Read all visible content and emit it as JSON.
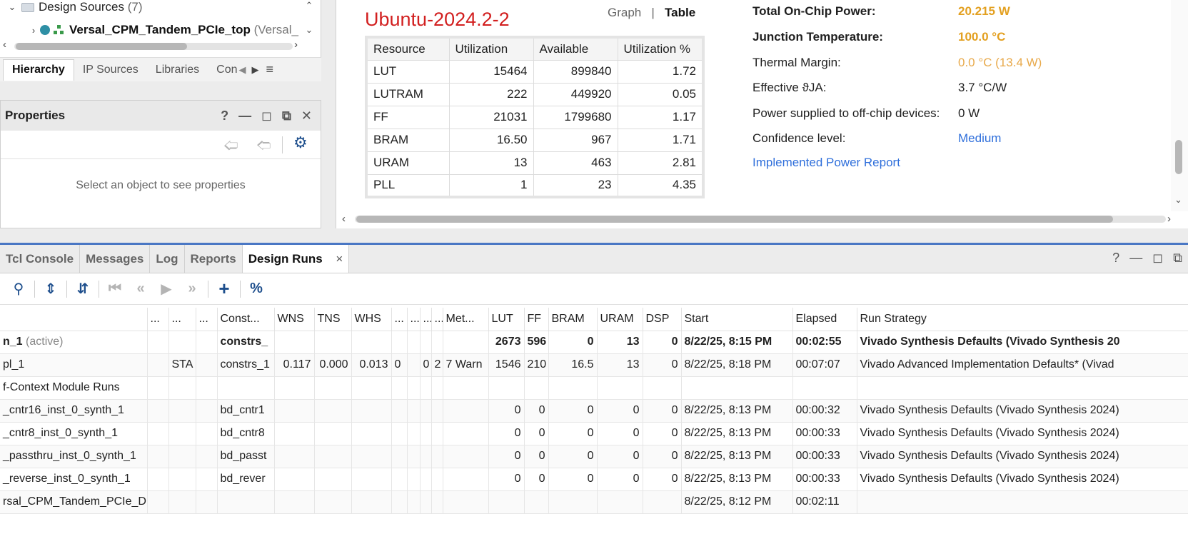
{
  "sources": {
    "design_sources_label": "Design Sources",
    "design_sources_count": "(7)",
    "top_module": "Versal_CPM_Tandem_PCIe_top",
    "top_module_suffix": "(Versal_",
    "tabs": [
      "Hierarchy",
      "IP Sources",
      "Libraries",
      "Con"
    ]
  },
  "properties": {
    "title": "Properties",
    "empty_message": "Select an object to see properties"
  },
  "dashboard": {
    "title": "Ubuntu-2024.2-2",
    "view_graph": "Graph",
    "view_sep": "|",
    "view_table": "Table",
    "util_headers": [
      "Resource",
      "Utilization",
      "Available",
      "Utilization %"
    ],
    "util_rows": [
      [
        "LUT",
        "15464",
        "899840",
        "1.72"
      ],
      [
        "LUTRAM",
        "222",
        "449920",
        "0.05"
      ],
      [
        "FF",
        "21031",
        "1799680",
        "1.17"
      ],
      [
        "BRAM",
        "16.50",
        "967",
        "1.71"
      ],
      [
        "URAM",
        "13",
        "463",
        "2.81"
      ],
      [
        "PLL",
        "1",
        "23",
        "4.35"
      ]
    ],
    "power": {
      "total_label": "Total On-Chip Power:",
      "total_value": "20.215 W",
      "junction_label": "Junction Temperature:",
      "junction_value": "100.0 °C",
      "margin_label": "Thermal Margin:",
      "margin_value": "0.0 °C (13.4 W)",
      "theta_label": "Effective ϑJA:",
      "theta_value": "3.7 °C/W",
      "offchip_label": "Power supplied to off-chip devices:",
      "offchip_value": "0 W",
      "confidence_label": "Confidence level:",
      "confidence_value": "Medium",
      "report_link": "Implemented Power Report"
    }
  },
  "bottom": {
    "tabs": [
      "Tcl Console",
      "Messages",
      "Log",
      "Reports",
      "Design Runs"
    ],
    "close_glyph": "×",
    "headers": [
      "",
      "...",
      "...",
      "...",
      "Const...",
      "WNS",
      "TNS",
      "WHS",
      "...",
      "...",
      "...",
      "...",
      "Met...",
      "LUT",
      "FF",
      "BRAM",
      "URAM",
      "DSP",
      "Start",
      "Elapsed",
      "Run Strategy"
    ],
    "rows": [
      {
        "name": "n_1",
        "name_suffix": "(active)",
        "c": [
          "",
          "",
          "",
          "constrs_",
          "",
          "",
          "",
          "",
          "",
          "",
          "",
          "",
          "2673",
          "596",
          "0",
          "13",
          "0",
          "8/22/25, 8:15 PM",
          "00:02:55",
          "Vivado Synthesis Defaults (Vivado Synthesis 20"
        ]
      },
      {
        "name": "pl_1",
        "name_suffix": "",
        "c": [
          "",
          "STA",
          "",
          "constrs_1",
          "0.117",
          "0.000",
          "0.013",
          "0",
          "",
          "0",
          "2",
          "7 Warn",
          "1546",
          "210",
          "16.5",
          "13",
          "0",
          "8/22/25, 8:18 PM",
          "00:07:07",
          "Vivado Advanced Implementation Defaults* (Vivad"
        ]
      },
      {
        "name": "f-Context Module Runs",
        "name_suffix": "",
        "c": [
          "",
          "",
          "",
          "",
          "",
          "",
          "",
          "",
          "",
          "",
          "",
          "",
          "",
          "",
          "",
          "",
          "",
          "",
          "",
          ""
        ]
      },
      {
        "name": "_cntr16_inst_0_synth_1",
        "name_suffix": "",
        "c": [
          "",
          "",
          "",
          "bd_cntr1",
          "",
          "",
          "",
          "",
          "",
          "",
          "",
          "",
          "0",
          "0",
          "0",
          "0",
          "0",
          "8/22/25, 8:13 PM",
          "00:00:32",
          "Vivado Synthesis Defaults (Vivado Synthesis 2024)"
        ]
      },
      {
        "name": "_cntr8_inst_0_synth_1",
        "name_suffix": "",
        "c": [
          "",
          "",
          "",
          "bd_cntr8",
          "",
          "",
          "",
          "",
          "",
          "",
          "",
          "",
          "0",
          "0",
          "0",
          "0",
          "0",
          "8/22/25, 8:13 PM",
          "00:00:33",
          "Vivado Synthesis Defaults (Vivado Synthesis 2024)"
        ]
      },
      {
        "name": "_passthru_inst_0_synth_1",
        "name_suffix": "",
        "c": [
          "",
          "",
          "",
          "bd_passt",
          "",
          "",
          "",
          "",
          "",
          "",
          "",
          "",
          "0",
          "0",
          "0",
          "0",
          "0",
          "8/22/25, 8:13 PM",
          "00:00:33",
          "Vivado Synthesis Defaults (Vivado Synthesis 2024)"
        ]
      },
      {
        "name": "_reverse_inst_0_synth_1",
        "name_suffix": "",
        "c": [
          "",
          "",
          "",
          "bd_rever",
          "",
          "",
          "",
          "",
          "",
          "",
          "",
          "",
          "0",
          "0",
          "0",
          "0",
          "0",
          "8/22/25, 8:13 PM",
          "00:00:33",
          "Vivado Synthesis Defaults (Vivado Synthesis 2024)"
        ]
      },
      {
        "name": "rsal_CPM_Tandem_PCIe_D",
        "name_suffix": "",
        "c": [
          "",
          "",
          "",
          "",
          "",
          "",
          "",
          "",
          "",
          "",
          "",
          "",
          "",
          "",
          "",
          "",
          "",
          "8/22/25, 8:12 PM",
          "00:02:11",
          ""
        ]
      }
    ]
  }
}
